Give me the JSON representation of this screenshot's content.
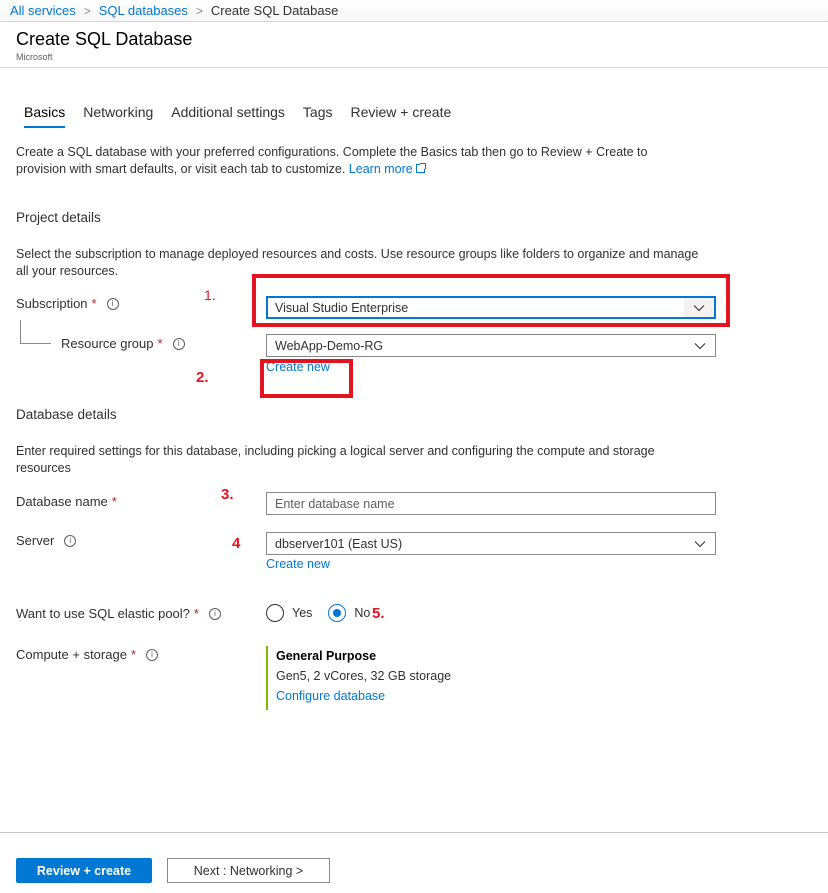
{
  "breadcrumb": {
    "items": [
      "All services",
      "SQL databases"
    ],
    "current": "Create SQL Database",
    "separator": ">"
  },
  "header": {
    "title": "Create SQL Database",
    "publisher": "Microsoft"
  },
  "tabs": [
    {
      "label": "Basics",
      "active": true
    },
    {
      "label": "Networking",
      "active": false
    },
    {
      "label": "Additional settings",
      "active": false
    },
    {
      "label": "Tags",
      "active": false
    },
    {
      "label": "Review + create",
      "active": false
    }
  ],
  "intro": {
    "text": "Create a SQL database with your preferred configurations. Complete the Basics tab then go to Review + Create to provision with smart defaults, or visit each tab to customize.",
    "learn_more": "Learn more"
  },
  "project_details": {
    "title": "Project details",
    "description": "Select the subscription to manage deployed resources and costs. Use resource groups like folders to organize and manage all your resources.",
    "subscription": {
      "label": "Subscription",
      "required": "*",
      "value": "Visual Studio Enterprise"
    },
    "resource_group": {
      "label": "Resource group",
      "required": "*",
      "value": "WebApp-Demo-RG",
      "create_new": "Create new"
    }
  },
  "database_details": {
    "title": "Database details",
    "description": "Enter required settings for this database, including picking a logical server and configuring the compute and storage resources",
    "database_name": {
      "label": "Database name",
      "required": "*",
      "value": "",
      "placeholder": "Enter database name"
    },
    "server": {
      "label": "Server",
      "value": "dbserver101 (East US)",
      "create_new": "Create new"
    },
    "elastic_pool": {
      "label": "Want to use SQL elastic pool?",
      "required": "*",
      "options": [
        "Yes",
        "No"
      ],
      "selected": "No"
    },
    "compute_storage": {
      "label": "Compute + storage",
      "required": "*",
      "tier": "General Purpose",
      "spec": "Gen5, 2 vCores, 32 GB storage",
      "configure_link": "Configure database"
    }
  },
  "annotations": [
    "1.",
    "2.",
    "3.",
    "4",
    "5."
  ],
  "footer": {
    "primary_button": "Review + create",
    "secondary_button": "Next : Networking >"
  },
  "icons": {
    "info": "i",
    "chevron": "chevron-down-icon",
    "external": "external-link-icon"
  },
  "colors": {
    "accent": "#0078d4",
    "annotation_red": "#e3141f",
    "compute_bar": "#7fba00",
    "required": "#a4262c"
  }
}
